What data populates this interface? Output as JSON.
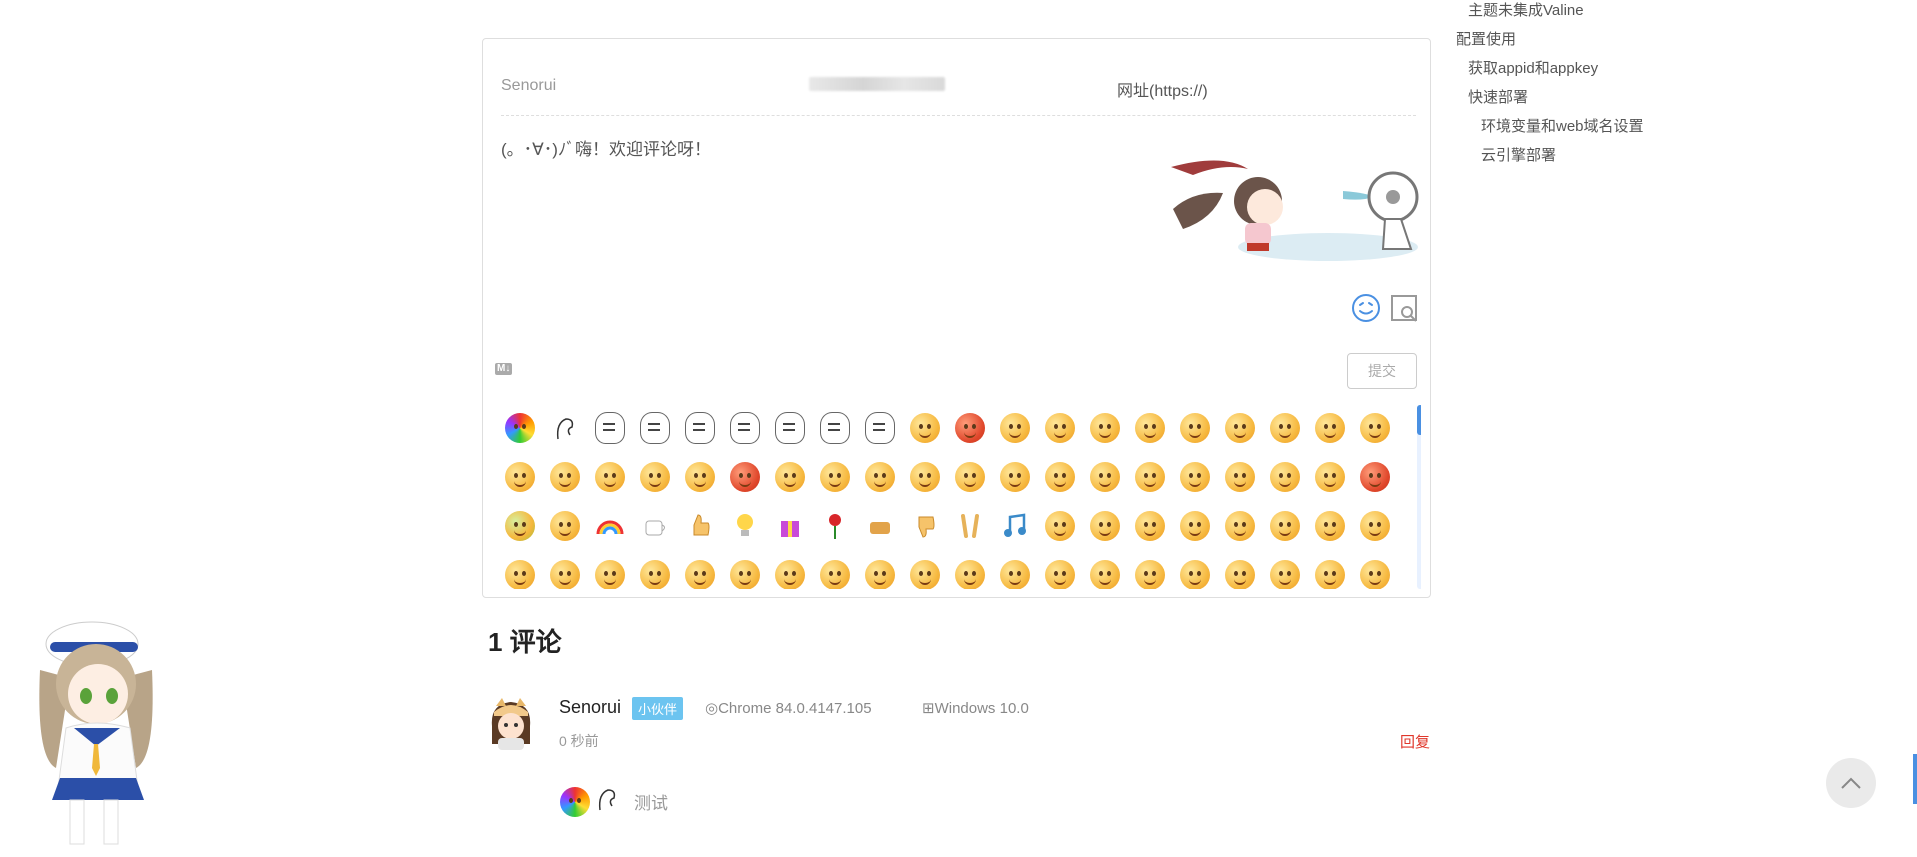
{
  "form": {
    "nick_placeholder": "Senorui",
    "link_placeholder": "网址(https://)",
    "editor_placeholder": "(。･∀･)ﾉﾞ嗨！欢迎评论呀！",
    "submit_label": "提交",
    "markdown_badge": "M↓"
  },
  "comments_header": {
    "count_label": "1 评论"
  },
  "comment": {
    "name": "Senorui",
    "badge": "小伙伴",
    "browser": "Chrome 84.0.4147.105",
    "os": "Windows 10.0",
    "time": "0 秒前",
    "reply_label": "回复",
    "text": "测试"
  },
  "toc": {
    "items": [
      {
        "label": "主题未集成Valine",
        "level": 2
      },
      {
        "label": "配置使用",
        "level": 1
      },
      {
        "label": "获取appid和appkey",
        "level": 2
      },
      {
        "label": "快速部署",
        "level": 2
      },
      {
        "label": "环境变量和web域名设置",
        "level": 3
      },
      {
        "label": "云引擎部署",
        "level": 3
      }
    ]
  },
  "colors": {
    "accent": "#4a90e2",
    "badge": "#6cc4f0",
    "reply": "#e0372b"
  }
}
